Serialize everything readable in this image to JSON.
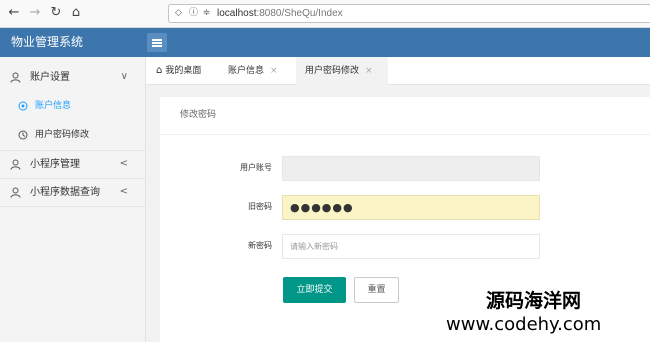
{
  "browser": {
    "url_host": "localhost",
    "url_path": ":8080/SheQu/Index"
  },
  "app": {
    "title": "物业管理系统"
  },
  "sidebar": {
    "groups": [
      {
        "label": "账户设置",
        "arrow": "∨"
      },
      {
        "label": "小程序管理",
        "arrow": "<"
      },
      {
        "label": "小程序数据查询",
        "arrow": "<"
      }
    ],
    "subitems": [
      {
        "label": "账户信息",
        "active": true
      },
      {
        "label": "用户密码修改",
        "active": false
      }
    ]
  },
  "tabs": [
    {
      "label": "我的桌面",
      "icon": "home-icon"
    },
    {
      "label": "账户信息",
      "close": "×"
    },
    {
      "label": "用户密码修改",
      "close": "×",
      "active": true
    }
  ],
  "form": {
    "title": "修改密码",
    "username_label": "用户账号",
    "old_password_label": "旧密码",
    "old_password_value": "●●●●●●",
    "new_password_label": "新密码",
    "new_password_placeholder": "请输入新密码",
    "submit_label": "立即提交",
    "reset_label": "重置"
  },
  "watermark": {
    "line1": "源码海洋网",
    "line2": "www.codehy.com"
  },
  "colors": {
    "header": "#3d76ad",
    "primary_button": "#009688",
    "active_link": "#1e9fff"
  }
}
